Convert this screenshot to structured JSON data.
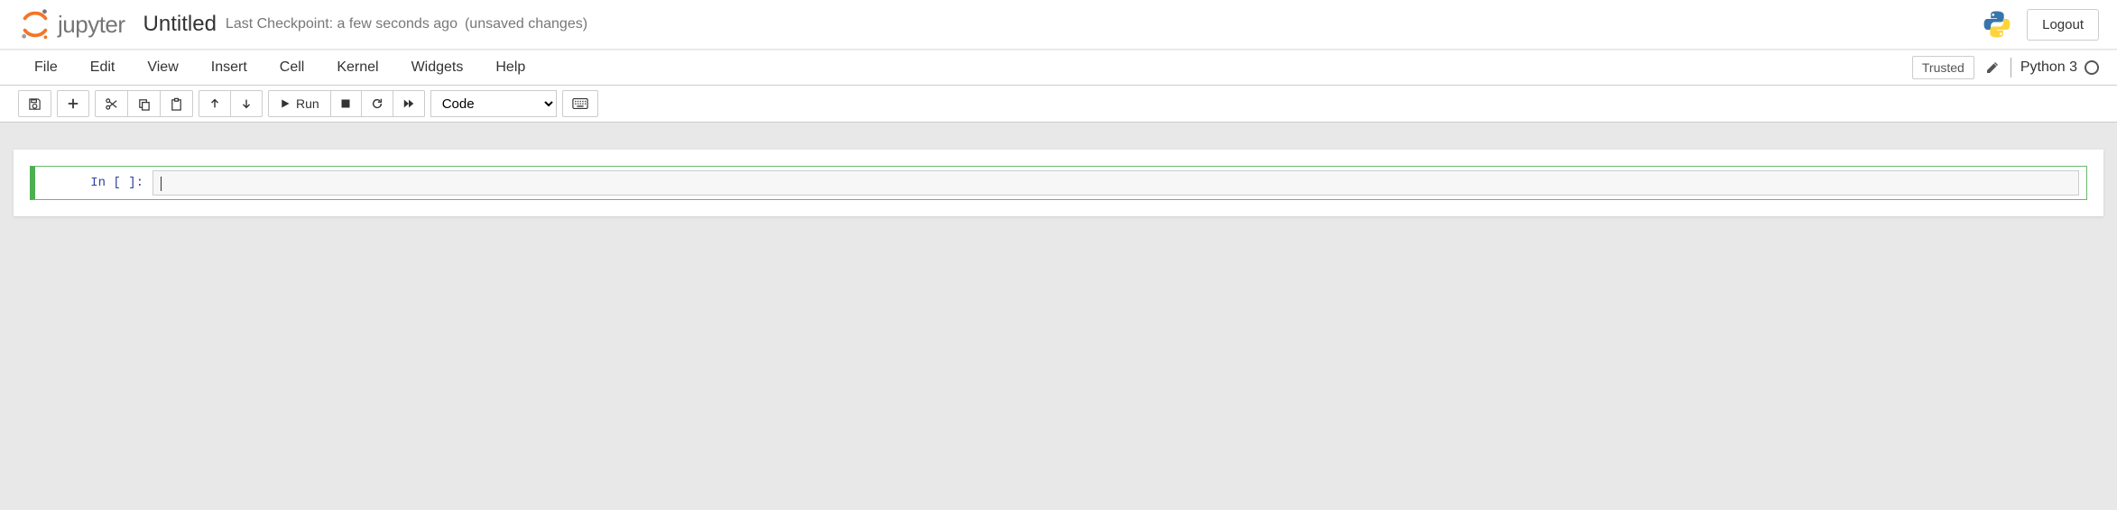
{
  "header": {
    "logo_text": "jupyter",
    "notebook_title": "Untitled",
    "checkpoint": "Last Checkpoint: a few seconds ago",
    "unsaved": "(unsaved changes)",
    "logout": "Logout"
  },
  "menubar": {
    "items": [
      "File",
      "Edit",
      "View",
      "Insert",
      "Cell",
      "Kernel",
      "Widgets",
      "Help"
    ],
    "trusted": "Trusted",
    "kernel_name": "Python 3"
  },
  "toolbar": {
    "run_label": "Run",
    "cell_type_selected": "Code"
  },
  "cell": {
    "prompt": "In [ ]:",
    "content": ""
  }
}
